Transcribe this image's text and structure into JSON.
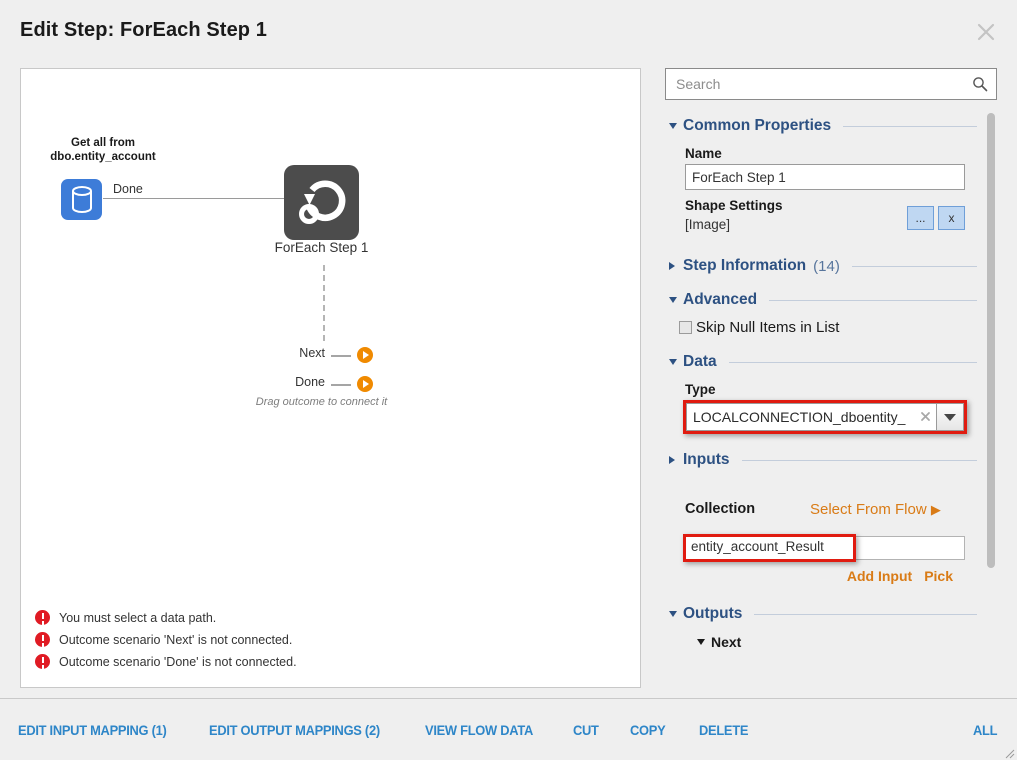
{
  "window": {
    "title": "Edit Step: ForEach Step 1",
    "close_icon": "close-icon"
  },
  "canvas": {
    "db_node": {
      "label": "Get all from dbo.entity_account",
      "icon": "database-icon",
      "connector_label": "Done"
    },
    "foreach_node": {
      "label": "ForEach Step 1",
      "icon": "foreach-loop-icon"
    },
    "outcomes": [
      {
        "label": "Next",
        "icon": "play-icon"
      },
      {
        "label": "Done",
        "icon": "play-icon"
      }
    ],
    "drag_hint": "Drag outcome to connect it",
    "errors": [
      "You must select a data path.",
      "Outcome scenario 'Next' is not connected.",
      "Outcome scenario 'Done' is not connected."
    ]
  },
  "panel": {
    "search": {
      "value": "",
      "placeholder": "Search",
      "icon": "search-icon"
    },
    "common_properties": {
      "title": "Common Properties",
      "expanded": true,
      "name_label": "Name",
      "name_value": "ForEach Step 1",
      "shape_settings_label": "Shape Settings",
      "shape_settings_value": "[Image]",
      "browse_button": "...",
      "clear_button": "x"
    },
    "step_information": {
      "title": "Step Information",
      "count": "(14)",
      "expanded": false
    },
    "advanced": {
      "title": "Advanced",
      "expanded": true,
      "skip_null_label": "Skip Null Items in List",
      "skip_null_checked": false
    },
    "data": {
      "title": "Data",
      "expanded": true,
      "type_label": "Type",
      "type_value": "LOCALCONNECTION_dboentity_",
      "clear_icon": "clear-x-icon",
      "dropdown_icon": "chevron-down-icon"
    },
    "inputs": {
      "title": "Inputs",
      "expanded": false,
      "collection_label": "Collection",
      "select_from_flow": "Select From Flow",
      "select_from_flow_arrow": "▶",
      "collection_value": "entity_account_Result",
      "add_input_label": "Add Input",
      "pick_label": "Pick"
    },
    "outputs": {
      "title": "Outputs",
      "expanded": true,
      "next_label": "Next",
      "next_expanded": true
    }
  },
  "footer": {
    "buttons": [
      "EDIT INPUT MAPPING (1)",
      "EDIT OUTPUT MAPPINGS (2)",
      "VIEW FLOW DATA",
      "CUT",
      "COPY",
      "DELETE"
    ],
    "all_label": "ALL"
  },
  "colors": {
    "accent_blue": "#2d5182",
    "link_blue": "#2e86c8",
    "orange": "#d97b16",
    "outcome_orange": "#f08a00",
    "error_red": "#e01b24",
    "highlight_red": "#e01b10",
    "db_node_blue": "#3d7cd8",
    "foreach_node_grey": "#4c4c4c"
  }
}
